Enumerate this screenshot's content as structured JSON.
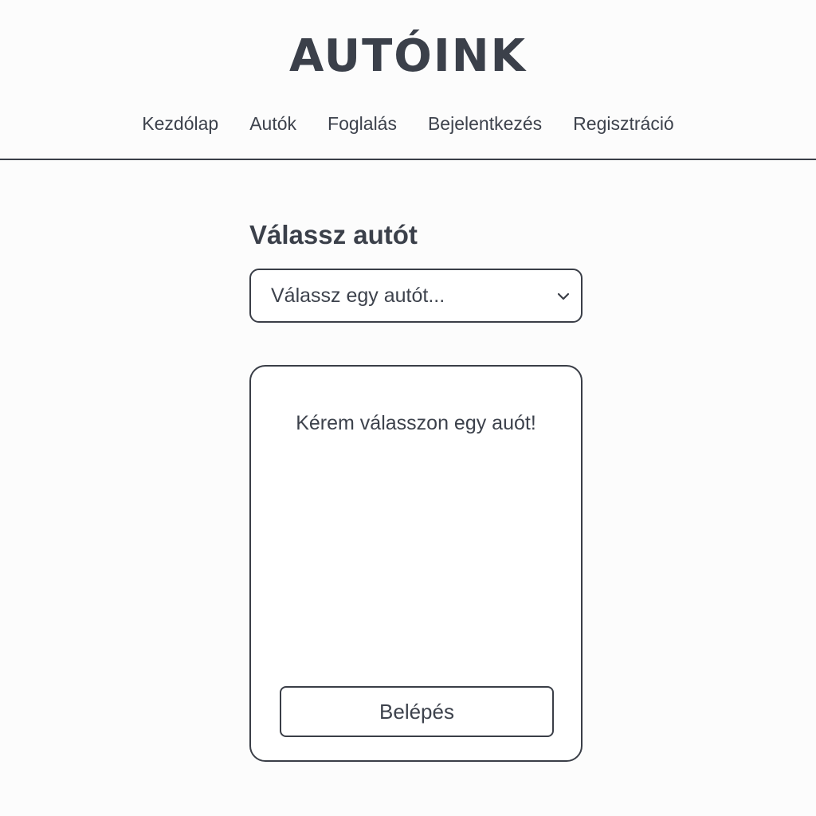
{
  "header": {
    "brand": "AUTÓINK",
    "nav": [
      {
        "label": "Kezdólap"
      },
      {
        "label": "Autók"
      },
      {
        "label": "Foglalás"
      },
      {
        "label": "Bejelentkezés"
      },
      {
        "label": "Regisztráció"
      }
    ]
  },
  "main": {
    "title": "Válassz autót",
    "select": {
      "value": "Válassz egy autót...",
      "icon": "chevron-down-icon"
    },
    "card": {
      "message": "Kérem válasszon egy auót!",
      "button_label": "Belépés"
    }
  },
  "colors": {
    "text": "#3d424c",
    "border": "#3a3e47",
    "background": "#fcfcfc"
  }
}
